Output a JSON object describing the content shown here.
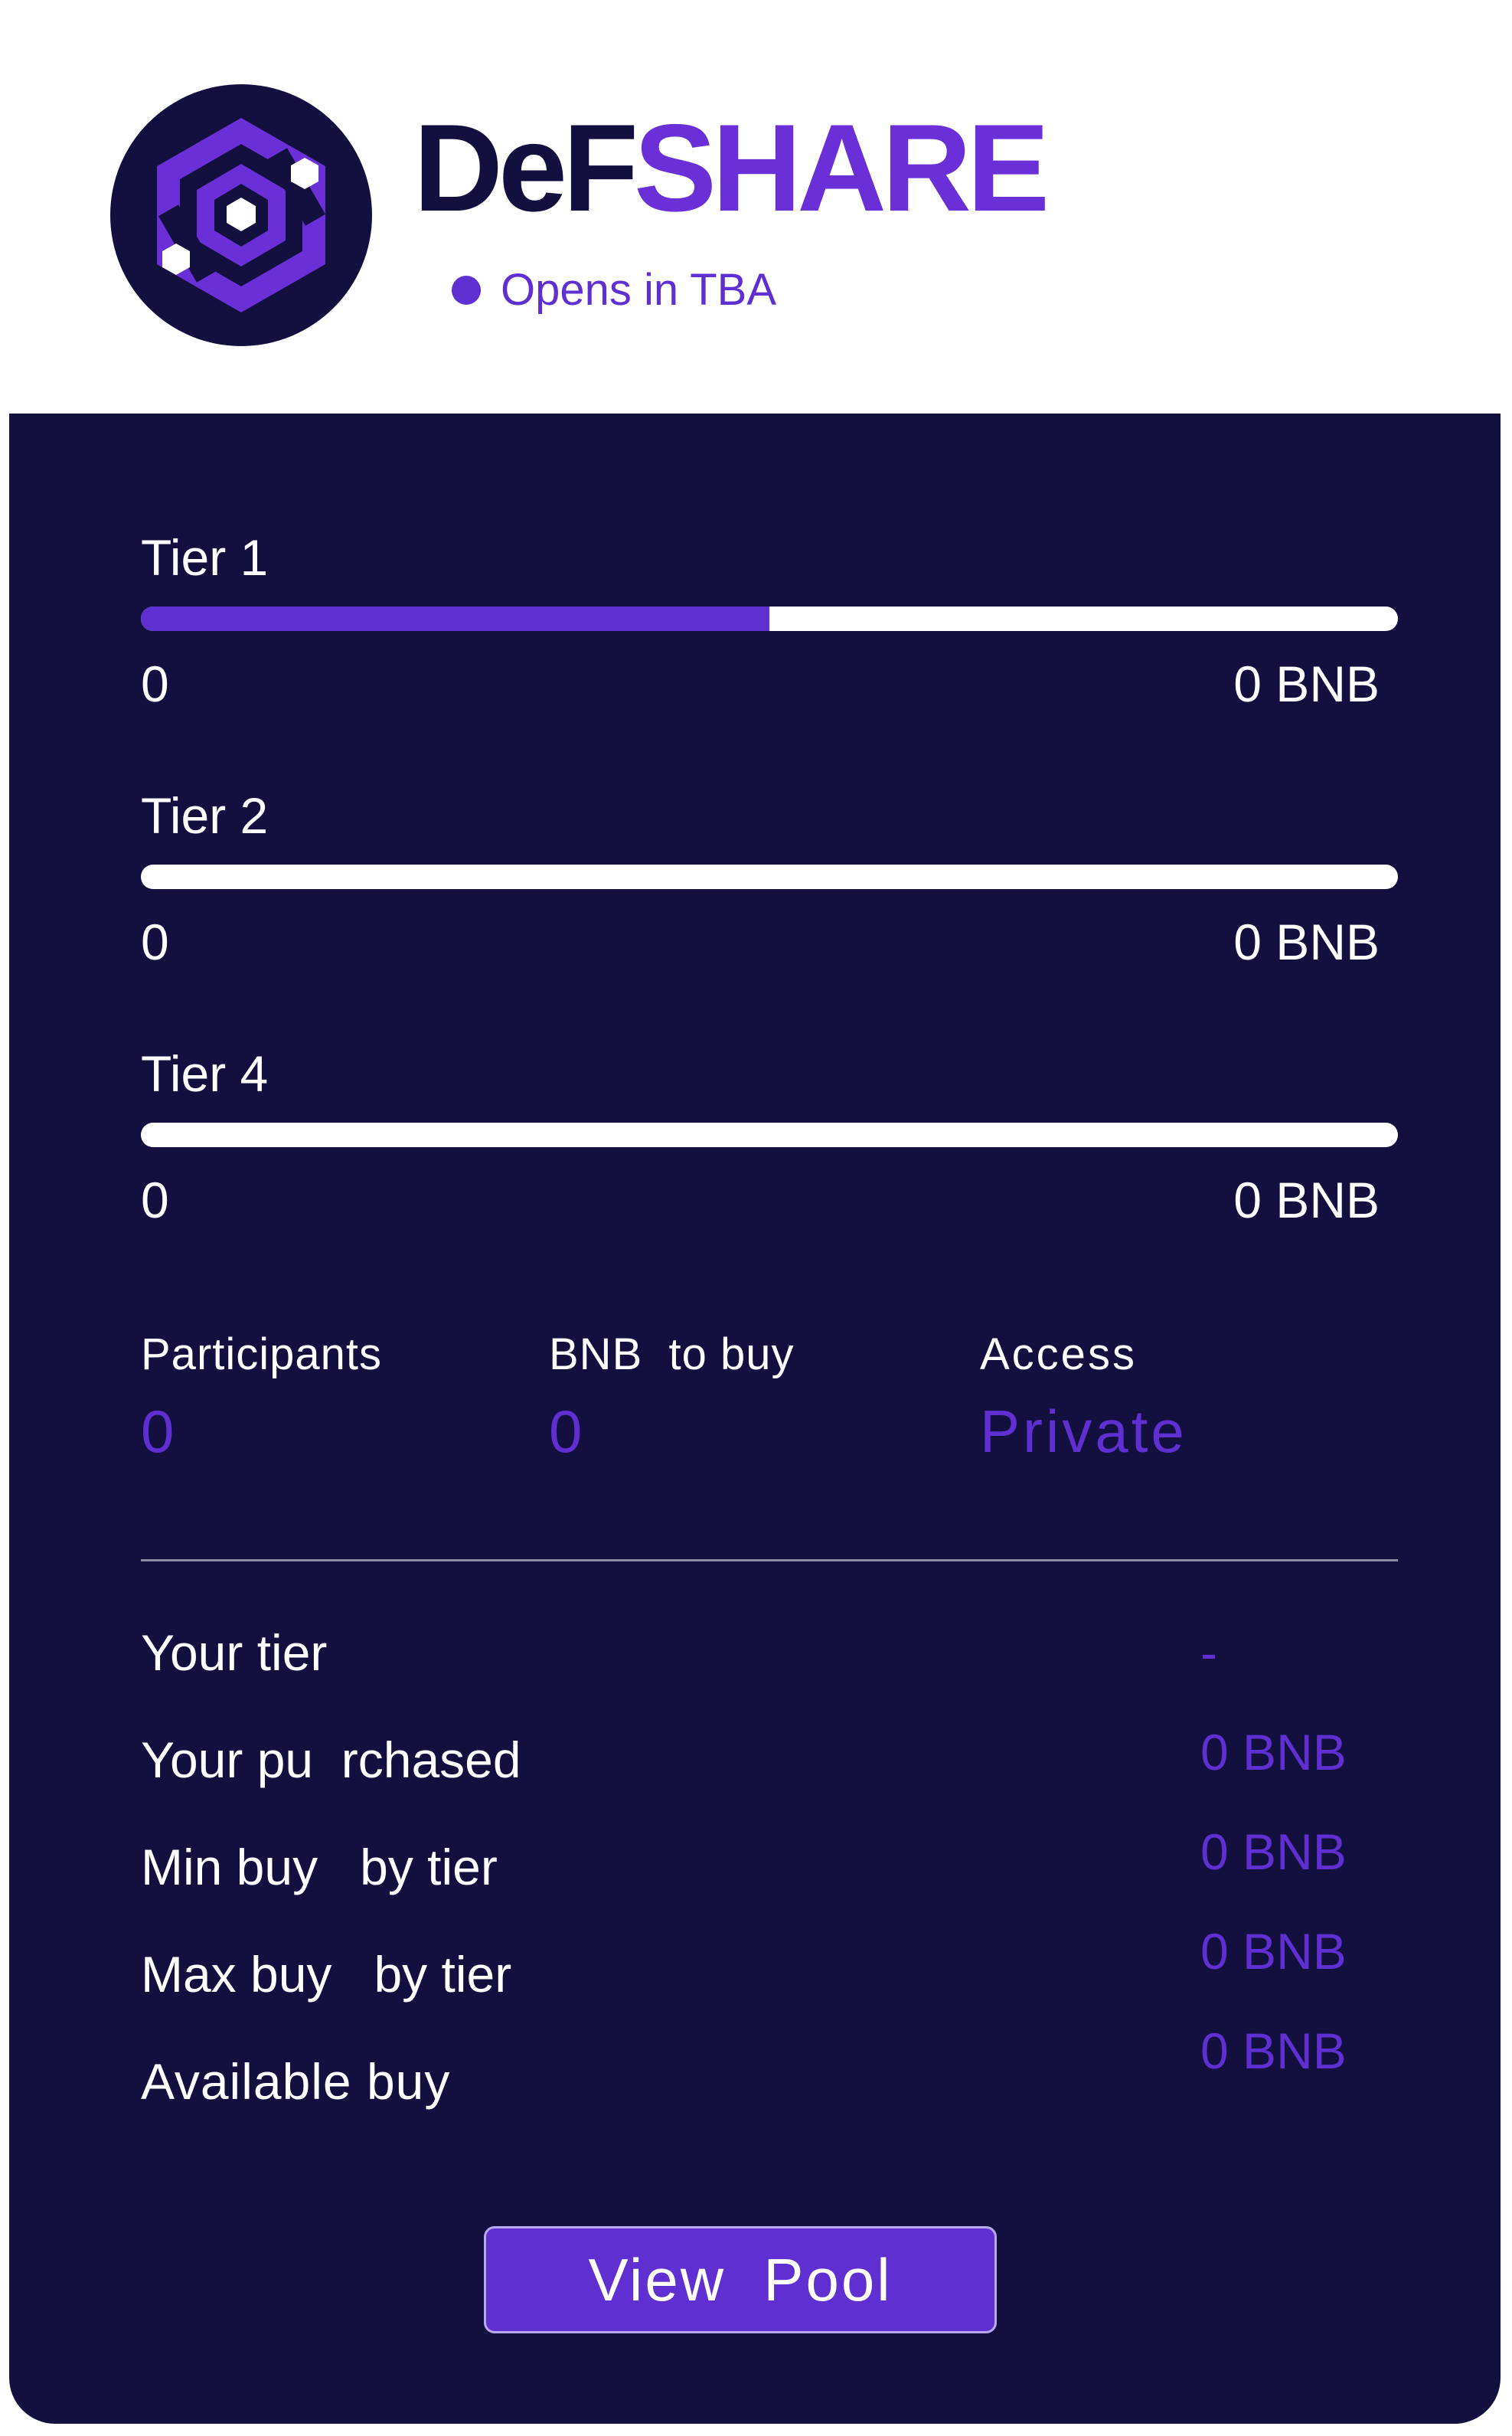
{
  "header": {
    "brand_dark": "DeF",
    "brand_accent": "SHARE",
    "status_text": "Opens in TBA",
    "logo_icon": "hexagon-logo-icon",
    "status_icon": "status-dot-icon"
  },
  "tiers": [
    {
      "name": "Tier 1",
      "min": "0",
      "max": "0 BNB",
      "progress_percent": 50
    },
    {
      "name": "Tier 2",
      "min": "0",
      "max": "0 BNB",
      "progress_percent": 0
    },
    {
      "name": "Tier 4",
      "min": "0",
      "max": "0 BNB",
      "progress_percent": 0
    }
  ],
  "stats": {
    "participants_label": "Participants",
    "participants_value": "0",
    "bnb_label": "BNB  to buy",
    "bnb_value": "0",
    "access_label": "Access",
    "access_value": "Private"
  },
  "info": {
    "your_tier_label": "Your tier",
    "your_tier_value": "-",
    "purchased_label": "Your pu  rchased",
    "purchased_value": "0 BNB",
    "min_buy_label": "Min buy   by tier",
    "min_buy_value": "0 BNB",
    "max_buy_label": "Max buy   by tier",
    "max_buy_value": "0 BNB",
    "available_label": "Available buy",
    "available_value": "0 BNB"
  },
  "actions": {
    "view_pool_label": "View  Pool"
  },
  "colors": {
    "accent": "#5f2fd2",
    "panel": "#13103f",
    "text_on_panel": "#ffffff"
  }
}
